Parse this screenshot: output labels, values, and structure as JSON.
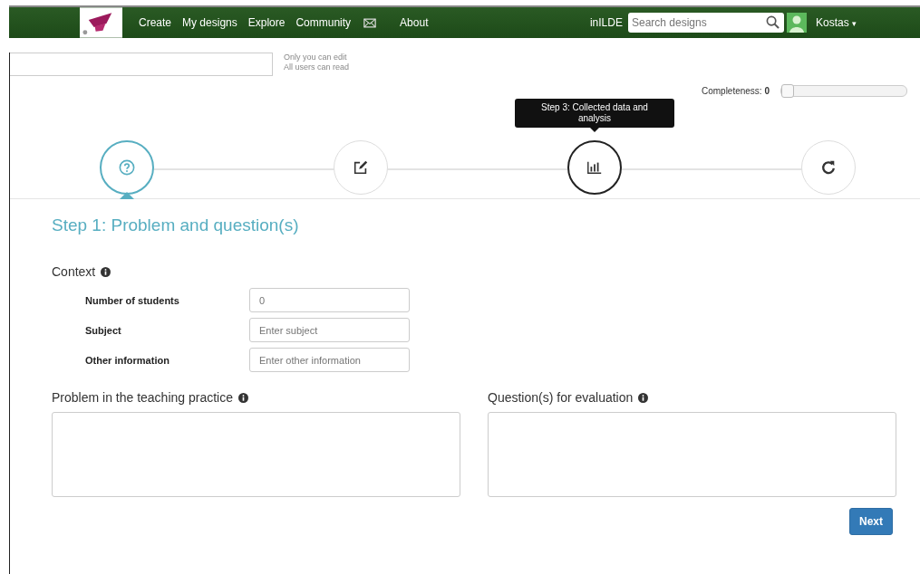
{
  "navbar": {
    "menu": [
      {
        "kind": "text",
        "label": "Create"
      },
      {
        "kind": "text",
        "label": "My designs"
      },
      {
        "kind": "text",
        "label": "Explore"
      },
      {
        "kind": "text",
        "label": "Community"
      },
      {
        "kind": "mail"
      },
      {
        "kind": "text",
        "label": "About"
      }
    ],
    "brand": "inILDE",
    "search": {
      "placeholder": "Search designs"
    },
    "user": "Kostas",
    "user_caret": "▾"
  },
  "permissions": [
    "Only you can edit",
    "All users can read"
  ],
  "completeness": {
    "label": "Completeness:",
    "value": "0",
    "level": 0
  },
  "steps": [
    {
      "kind": "question",
      "selected": true,
      "highlighted": false
    },
    {
      "kind": "edit",
      "selected": false,
      "highlighted": false
    },
    {
      "kind": "chart",
      "selected": false,
      "highlighted": true,
      "tooltip": "Step 3: Collected data and analysis"
    },
    {
      "kind": "refresh",
      "selected": false,
      "highlighted": false
    }
  ],
  "heading": "Step 1: Problem and question(s)",
  "context": {
    "title": "Context",
    "fields": [
      {
        "label": "Number of students",
        "placeholder": "0"
      },
      {
        "label": "Subject",
        "placeholder": "Enter subject"
      },
      {
        "label": "Other information",
        "placeholder": "Enter other information"
      }
    ]
  },
  "text_areas": [
    {
      "label": "Problem in the teaching practice"
    },
    {
      "label": "Question(s) for evaluation"
    }
  ],
  "next_button": "Next"
}
